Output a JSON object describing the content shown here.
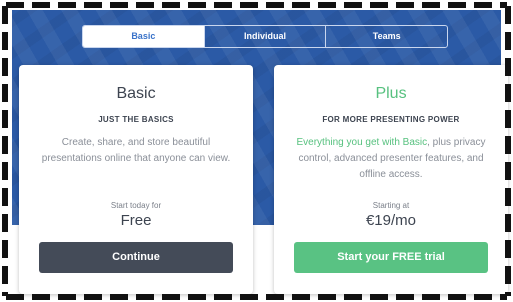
{
  "tabs": [
    {
      "label": "Basic",
      "active": true
    },
    {
      "label": "Individual",
      "active": false
    },
    {
      "label": "Teams",
      "active": false
    }
  ],
  "plans": {
    "basic": {
      "name": "Basic",
      "tagline": "JUST THE BASICS",
      "description": "Create, share, and store beautiful presentations online that anyone can view.",
      "price_label": "Start today for",
      "price": "Free",
      "cta": "Continue"
    },
    "plus": {
      "name": "Plus",
      "tagline": "FOR MORE PRESENTING POWER",
      "description_highlight": "Everything you get with Basic",
      "description_rest": ", plus privacy control, advanced presenter features, and offline access.",
      "price_label": "Starting at",
      "price": "€19/mo",
      "cta": "Start your FREE trial"
    }
  },
  "colors": {
    "hero_blue": "#2b5aa6",
    "accent_green": "#57c17f",
    "dark_button": "#444b58",
    "tab_active_text": "#3a73c9"
  }
}
